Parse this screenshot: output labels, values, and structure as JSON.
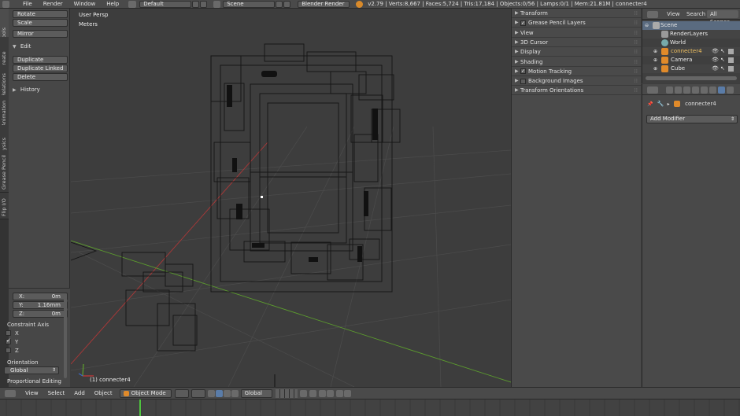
{
  "topbar": {
    "menus": [
      "File",
      "Render",
      "Window",
      "Help"
    ],
    "layout": "Default",
    "scene": "Scene",
    "engine": "Blender Render",
    "stats": "v2.79 | Verts:8,667 | Faces:5,724 | Tris:17,184 | Objects:0/56 | Lamps:0/1 | Mem:21.81M | connecter4"
  },
  "tabs": [
    "Tools",
    "Create",
    "Relations",
    "Animation",
    "Physics",
    "Grease Pencil",
    "Flip I/O"
  ],
  "shelf": {
    "transform_buttons": [
      "Rotate",
      "Scale"
    ],
    "mirror": "Mirror",
    "edit_header": "Edit",
    "edit_buttons": [
      "Duplicate",
      "Duplicate Linked",
      "Delete"
    ],
    "history_header": "History"
  },
  "operator": {
    "x_label": "X:",
    "x_value": "0m",
    "y_label": "Y:",
    "y_value": "1.16mm",
    "z_label": "Z:",
    "z_value": "0m",
    "constraint_axis": "Constraint Axis",
    "axes": [
      "X",
      "Y",
      "Z"
    ],
    "axes_checked": [
      false,
      true,
      false
    ],
    "orientation_label": "Orientation",
    "orientation_value": "Global",
    "proportional": "Proportional Editing"
  },
  "viewport": {
    "view_name": "User Persp",
    "units": "Meters",
    "object_label": "(1)  connecter4"
  },
  "props_panels": [
    {
      "label": "Transform",
      "checkbox": false
    },
    {
      "label": "Grease Pencil Layers",
      "checkbox": true
    },
    {
      "label": "View",
      "checkbox": false
    },
    {
      "label": "3D Cursor",
      "checkbox": false
    },
    {
      "label": "Display",
      "checkbox": false
    },
    {
      "label": "Shading",
      "checkbox": false
    },
    {
      "label": "Motion Tracking",
      "checkbox": true
    },
    {
      "label": "Background Images",
      "checkbox": true
    },
    {
      "label": "Transform Orientations",
      "checkbox": false
    }
  ],
  "outliner": {
    "tabs": [
      "View",
      "Search",
      "All Scenes"
    ],
    "items": [
      "Scene",
      "RenderLayers",
      "World",
      "connecter4",
      "Camera",
      "Cube"
    ]
  },
  "modifier": {
    "object_name": "connecter4",
    "add_modifier": "Add Modifier"
  },
  "bottombar": {
    "menus": [
      "View",
      "Select",
      "Add",
      "Object"
    ],
    "mode": "Object Mode",
    "orientation": "Global"
  },
  "colors": {
    "x_axis": "#b03838",
    "y_axis": "#5c9c2e",
    "selection": "#5a6b80",
    "background": "#3d3d3d"
  }
}
